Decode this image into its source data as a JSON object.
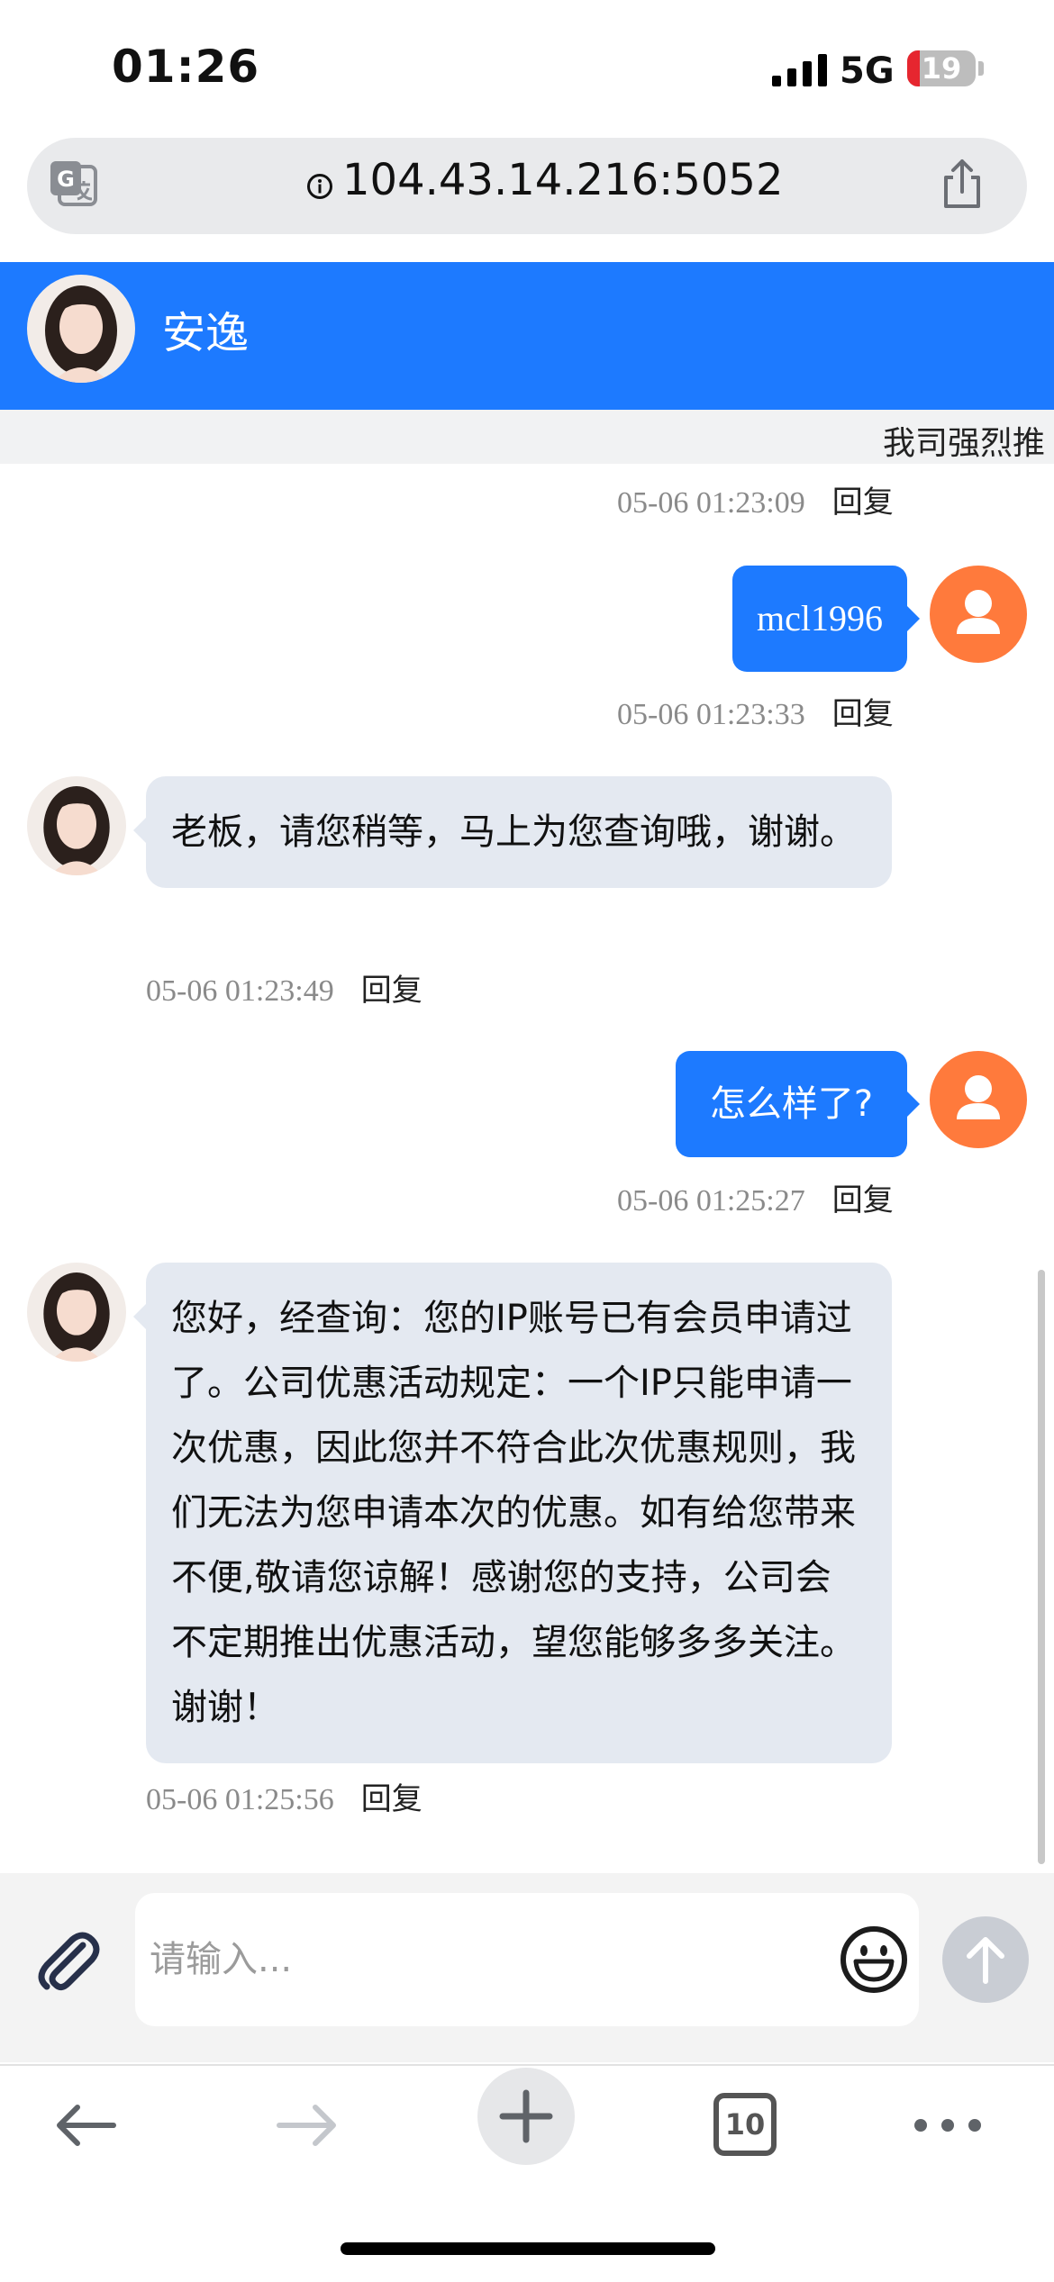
{
  "status_bar": {
    "time": "01:26",
    "network": "5G",
    "battery": "19",
    "battery_level": 0.19
  },
  "browser": {
    "url": "104.43.14.216:5052",
    "tab_count": "10"
  },
  "chat": {
    "agent_name": "安逸",
    "marquee": "我司强烈推",
    "messages": [
      {
        "from": "agent",
        "timestamp": "05-06 01:23:09",
        "reply": "回复"
      },
      {
        "from": "user",
        "text": "mcl1996",
        "timestamp": "05-06 01:23:33",
        "reply": "回复"
      },
      {
        "from": "agent",
        "text": "老板，请您稍等，马上为您查询哦，谢谢。",
        "timestamp": "05-06 01:23:49",
        "reply": "回复"
      },
      {
        "from": "user",
        "text": "怎么样了?",
        "timestamp": "05-06 01:25:27",
        "reply": "回复"
      },
      {
        "from": "agent",
        "text": "您好，经查询：您的IP账号已有会员申请过了。公司优惠活动规定：一个IP只能申请一次优惠，因此您并不符合此次优惠规则，我们无法为您申请本次的优惠。如有给您带来不便,敬请您谅解！感谢您的支持，公司会不定期推出优惠活动，望您能够多多关注。谢谢！",
        "timestamp": "05-06 01:25:56",
        "reply": "回复"
      }
    ]
  },
  "composer": {
    "placeholder": "请输入..."
  }
}
